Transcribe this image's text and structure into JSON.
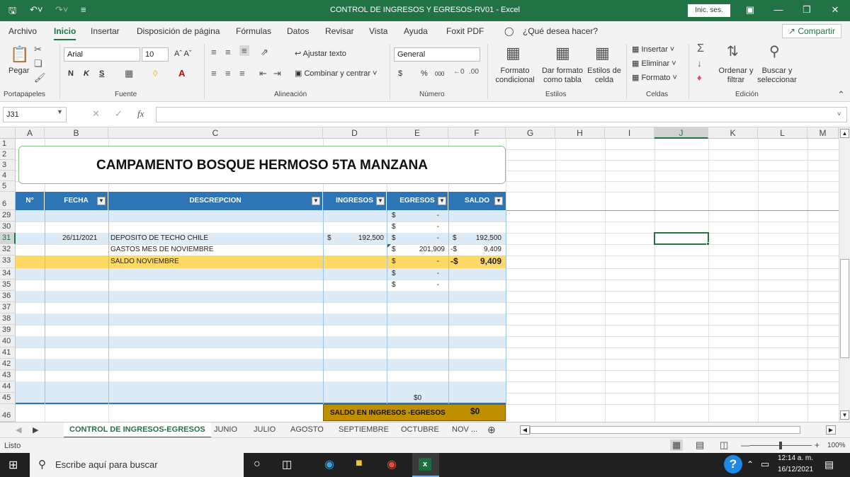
{
  "window": {
    "title": "CONTROL DE INGRESOS Y EGRESOS-RV01  -  Excel",
    "signin": "Inic. ses."
  },
  "ribbon_tabs": [
    "Archivo",
    "Inicio",
    "Insertar",
    "Disposición de página",
    "Fórmulas",
    "Datos",
    "Revisar",
    "Vista",
    "Ayuda",
    "Foxit PDF"
  ],
  "tell_me": "¿Qué desea hacer?",
  "share": "Compartir",
  "ribbon": {
    "clipboard": {
      "paste": "Pegar",
      "label": "Portapapeles"
    },
    "font": {
      "name": "Arial",
      "size": "10",
      "bold": "N",
      "italic": "K",
      "underline": "S",
      "label": "Fuente"
    },
    "alignment": {
      "wrap": "Ajustar texto",
      "merge": "Combinar y centrar",
      "label": "Alineación"
    },
    "number": {
      "format": "General",
      "currency": "$",
      "percent": "%",
      "thousands": "000",
      "label": "Número"
    },
    "styles": {
      "cond": "Formato condicional",
      "table": "Dar formato como tabla",
      "cell": "Estilos de celda",
      "label": "Estilos"
    },
    "cells": {
      "insert": "Insertar",
      "delete": "Eliminar",
      "format": "Formato",
      "label": "Celdas"
    },
    "editing": {
      "sort": "Ordenar y filtrar",
      "find": "Buscar y seleccionar",
      "label": "Edición"
    }
  },
  "namebox": "J31",
  "fx": "fx",
  "columns": [
    "A",
    "B",
    "C",
    "D",
    "E",
    "F",
    "G",
    "H",
    "I",
    "J",
    "K",
    "L",
    "M"
  ],
  "rows": [
    "1",
    "2",
    "3",
    "4",
    "5",
    "6",
    "29",
    "30",
    "31",
    "32",
    "33",
    "34",
    "35",
    "36",
    "37",
    "38",
    "39",
    "40",
    "41",
    "42",
    "43",
    "44",
    "45",
    "46"
  ],
  "sheet_title": "CAMPAMENTO BOSQUE HERMOSO 5TA MANZANA",
  "table_headers": [
    "N°",
    "FECHA",
    "DESCREPCION",
    "INGRESOS",
    "EGRESOS",
    "SALDO"
  ],
  "table_rows": [
    {
      "row": "29",
      "fecha": "",
      "desc": "",
      "ing_sym": "",
      "ing": "",
      "eg_sym": "$",
      "eg": "-",
      "sal_sym": "",
      "sal": ""
    },
    {
      "row": "30",
      "fecha": "",
      "desc": "",
      "ing_sym": "",
      "ing": "",
      "eg_sym": "$",
      "eg": "-",
      "sal_sym": "",
      "sal": ""
    },
    {
      "row": "31",
      "fecha": "26/11/2021",
      "desc": "DEPOSITO DE TECHO CHILE",
      "ing_sym": "$",
      "ing": "192,500",
      "eg_sym": "$",
      "eg": "-",
      "sal_sym": "$",
      "sal": "192,500"
    },
    {
      "row": "32",
      "fecha": "",
      "desc": "GASTOS MES DE NOVIEMBRE",
      "ing_sym": "",
      "ing": "",
      "eg_sym": "$",
      "eg": "201,909",
      "sal_sym": "-$",
      "sal": "9,409"
    },
    {
      "row": "33",
      "fecha": "",
      "desc": "SALDO NOVIEMBRE",
      "ing_sym": "",
      "ing": "",
      "eg_sym": "$",
      "eg": "-",
      "sal_sym": "-$",
      "sal": "9,409"
    },
    {
      "row": "34",
      "fecha": "",
      "desc": "",
      "ing_sym": "",
      "ing": "",
      "eg_sym": "$",
      "eg": "-",
      "sal_sym": "",
      "sal": ""
    },
    {
      "row": "35",
      "fecha": "",
      "desc": "",
      "ing_sym": "",
      "ing": "",
      "eg_sym": "$",
      "eg": "-",
      "sal_sym": "",
      "sal": ""
    }
  ],
  "total_row": {
    "eg": "$0"
  },
  "summary": {
    "label": "SALDO EN INGRESOS -EGRESOS",
    "value": "$0"
  },
  "sheets": [
    "CONTROL DE INGRESOS-EGRESOS",
    "JUNIO",
    "JULIO",
    "AGOSTO",
    "SEPTIEMBRE",
    "OCTUBRE",
    "NOV ..."
  ],
  "status": {
    "ready": "Listo",
    "zoom": "100%"
  },
  "taskbar": {
    "search": "Escribe aquí para buscar",
    "time": "12:14 a. m.",
    "date": "16/12/2021"
  },
  "colors": {
    "excel_green": "#217346",
    "header_blue": "#2e75b6",
    "band_blue": "#ddebf7",
    "highlight_yellow": "#ffd966",
    "summary_gold": "#bf8f00"
  }
}
